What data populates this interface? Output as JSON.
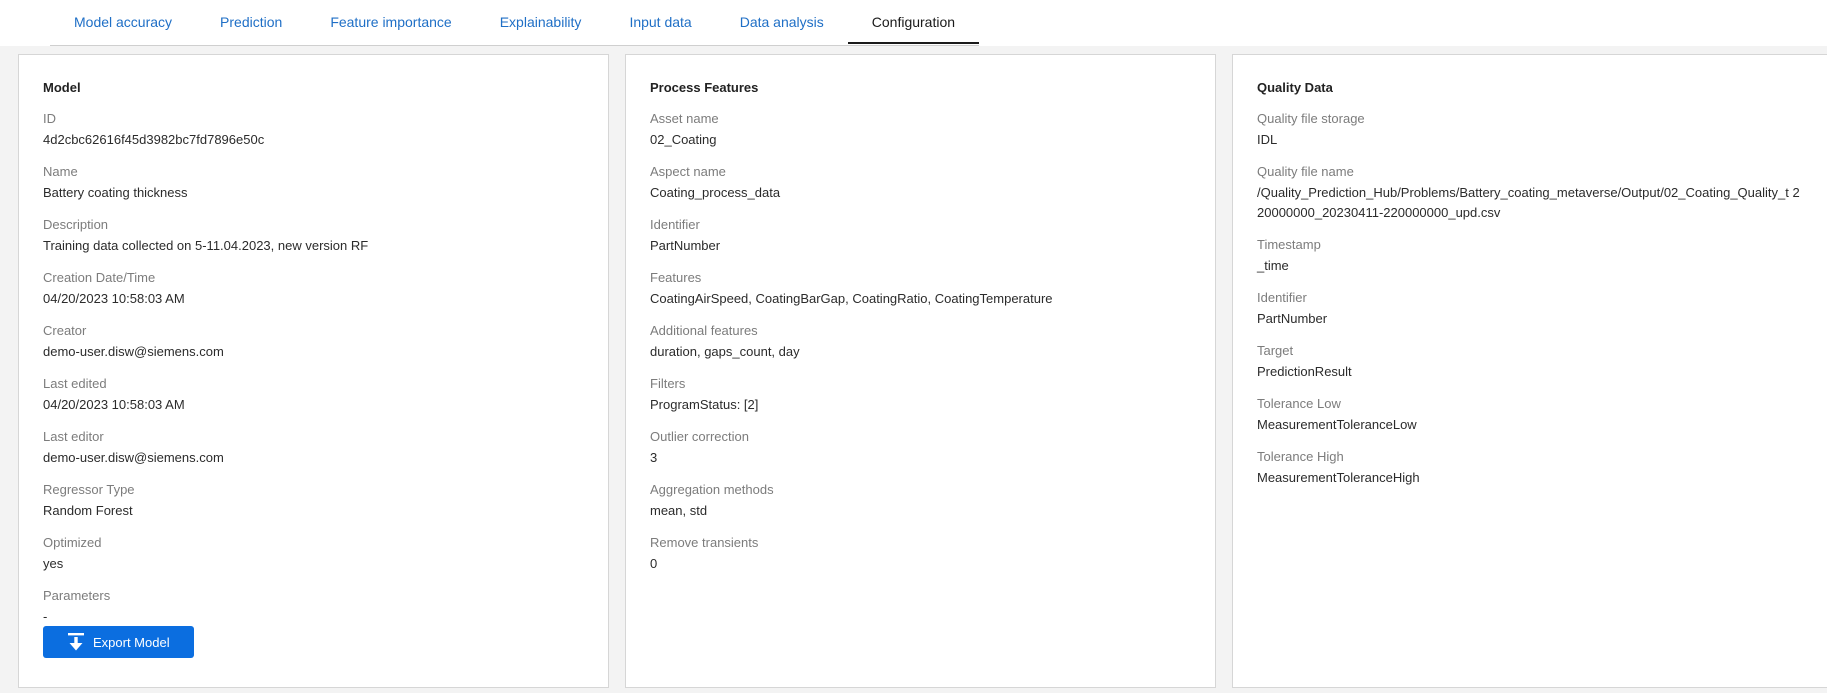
{
  "tabs": [
    {
      "label": "Model accuracy"
    },
    {
      "label": "Prediction"
    },
    {
      "label": "Feature importance"
    },
    {
      "label": "Explainability"
    },
    {
      "label": "Input data"
    },
    {
      "label": "Data analysis"
    },
    {
      "label": "Configuration",
      "active": true
    }
  ],
  "model": {
    "title": "Model",
    "fields": [
      {
        "label": "ID",
        "value": "4d2cbc62616f45d3982bc7fd7896e50c"
      },
      {
        "label": "Name",
        "value": "Battery coating thickness"
      },
      {
        "label": "Description",
        "value": "Training data collected on 5-11.04.2023, new version RF"
      },
      {
        "label": "Creation Date/Time",
        "value": "04/20/2023 10:58:03 AM"
      },
      {
        "label": "Creator",
        "value": "demo-user.disw@siemens.com"
      },
      {
        "label": "Last edited",
        "value": "04/20/2023 10:58:03 AM"
      },
      {
        "label": "Last editor",
        "value": "demo-user.disw@siemens.com"
      },
      {
        "label": "Regressor Type",
        "value": "Random Forest"
      },
      {
        "label": "Optimized",
        "value": "yes"
      },
      {
        "label": "Parameters",
        "value": "-"
      }
    ],
    "export_label": "Export Model",
    "export_icon": "download-icon"
  },
  "process": {
    "title": "Process Features",
    "fields": [
      {
        "label": "Asset name",
        "value": "02_Coating"
      },
      {
        "label": "Aspect name",
        "value": "Coating_process_data"
      },
      {
        "label": "Identifier",
        "value": "PartNumber"
      },
      {
        "label": "Features",
        "value": "CoatingAirSpeed, CoatingBarGap, CoatingRatio, CoatingTemperature"
      },
      {
        "label": "Additional features",
        "value": "duration, gaps_count, day"
      },
      {
        "label": "Filters",
        "value": "ProgramStatus: [2]"
      },
      {
        "label": "Outlier correction",
        "value": "3"
      },
      {
        "label": "Aggregation methods",
        "value": "mean, std"
      },
      {
        "label": "Remove transients",
        "value": "0"
      }
    ]
  },
  "quality": {
    "title": "Quality Data",
    "fields": [
      {
        "label": "Quality file storage",
        "value": "IDL"
      },
      {
        "label": "Quality file name",
        "value": "/Quality_Prediction_Hub/Problems/Battery_coating_metaverse/Output/02_Coating_Quality_t 220000000_20230411-220000000_upd.csv"
      },
      {
        "label": "Timestamp",
        "value": "_time"
      },
      {
        "label": "Identifier",
        "value": "PartNumber"
      },
      {
        "label": "Target",
        "value": "PredictionResult"
      },
      {
        "label": "Tolerance Low",
        "value": "MeasurementToleranceLow"
      },
      {
        "label": "Tolerance High",
        "value": "MeasurementToleranceHigh"
      }
    ]
  },
  "colors": {
    "link": "#1f6fc6",
    "primary_button": "#0b6ee0",
    "background": "#f3f3f3"
  }
}
